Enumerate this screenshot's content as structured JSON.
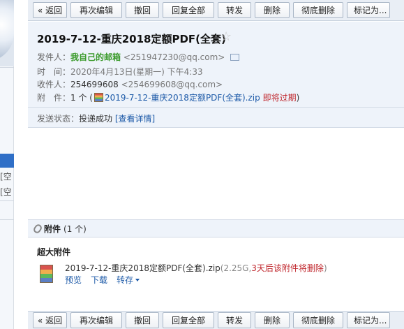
{
  "toolbar": {
    "back": "« 返回",
    "reedit": "再次编辑",
    "recall": "撤回",
    "reply_all": "回复全部",
    "forward": "转发",
    "delete": "删除",
    "delete_perm": "彻底删除",
    "mark_as": "标记为..."
  },
  "left_fragments": [
    "空]",
    "空]"
  ],
  "mail": {
    "subject": "2019-7-12-重庆2018定额PDF(全套)",
    "star": "☆",
    "from_label": "发件人：",
    "from_name": "我自己的邮箱",
    "from_addr": "<251947230@qq.com>",
    "time_label": "时　间：",
    "time_value": "2020年4月13日(星期一) 下午4:33",
    "to_label": "收件人：",
    "to_name": "254699608",
    "to_addr": "<254699608@qq.com>",
    "att_label": "附　件：",
    "att_count": "1 个 (",
    "att_file": "2019-7-12-重庆2018定额PDF(全套).zip",
    "att_expire": "即将过期",
    "att_close": ")",
    "status_label": "发送状态：",
    "status_value": "投递成功",
    "status_link": "[查看详情]"
  },
  "attachments": {
    "title": "附件",
    "count": "(1 个)",
    "super_label": "超大附件",
    "file_name": "2019-7-12-重庆2018定额PDF(全套).zip",
    "file_size": "(2.25G,",
    "file_warn": "3天后该附件将删除",
    "file_close": ")",
    "preview": "预览",
    "download": "下载",
    "save_to": "转存"
  }
}
